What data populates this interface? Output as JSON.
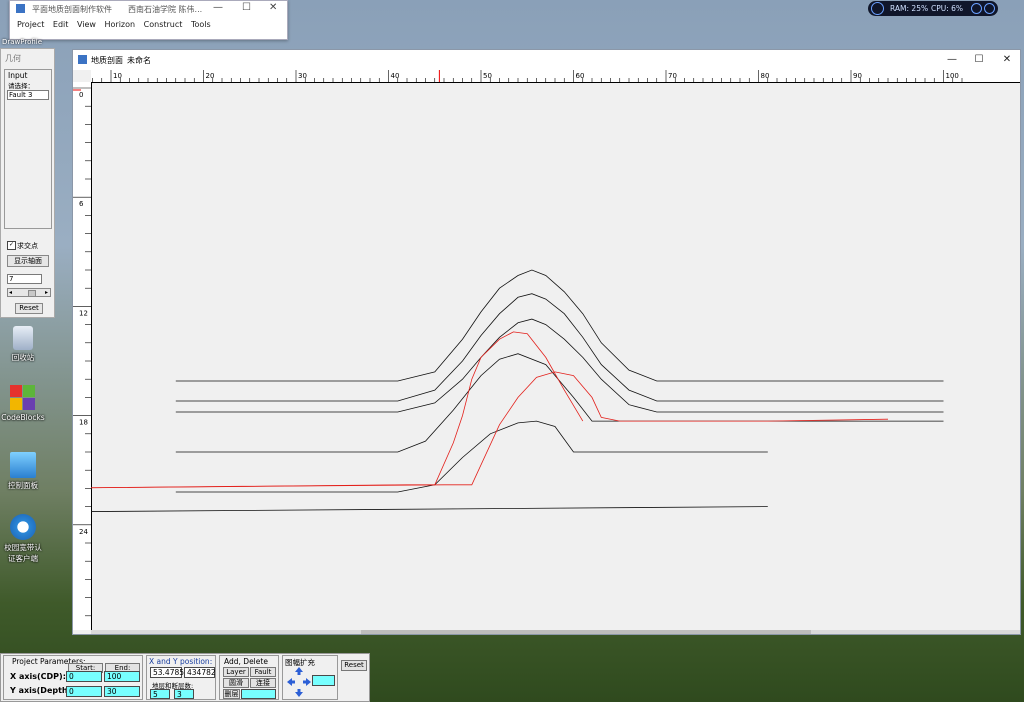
{
  "top_window": {
    "title": "平面地质剖面制作软件",
    "subtitle": "西南石油学院  陈伟...",
    "menu": [
      "Project",
      "Edit",
      "View",
      "Horizon",
      "Construct",
      "Tools"
    ],
    "controls": [
      "—",
      "☐",
      "✕"
    ]
  },
  "taskbar_label": "DrawProfile",
  "toolbox": {
    "title": "几何",
    "group_label": "Input",
    "hint": "请选择：",
    "selected_item": "Fault 3",
    "checkbox_label": "求交点",
    "checkbox_checked": true,
    "show_button": "显示轴面",
    "value_field": "7",
    "reset_button": "Reset"
  },
  "desktop_icons": [
    {
      "name": "recycle-bin",
      "label": "回收站"
    },
    {
      "name": "codeblocks",
      "label": "CodeBlocks"
    },
    {
      "name": "control-panel",
      "label": "控制面板"
    },
    {
      "name": "campus-auth",
      "label": "校园宽带认\n证客户端"
    }
  ],
  "main_window": {
    "title": "地质剖面",
    "doc_name": "未命名",
    "controls": [
      "—",
      "☐",
      "✕"
    ]
  },
  "rulers": {
    "x_ticks": [
      "10",
      "20",
      "30",
      "40",
      "50",
      "60",
      "70",
      "80",
      "90",
      "100"
    ],
    "y_ticks": [
      "0",
      "6",
      "12",
      "18",
      "24"
    ]
  },
  "cross_section": {
    "x_range": [
      0,
      100
    ],
    "depth_range": [
      0,
      30
    ],
    "horizons": [
      [
        [
          17,
          16.1
        ],
        [
          41,
          16.1
        ],
        [
          45,
          15.6
        ],
        [
          48,
          13.8
        ],
        [
          50,
          12.3
        ],
        [
          52,
          11.0
        ],
        [
          54,
          10.3
        ],
        [
          55.5,
          10.0
        ],
        [
          57,
          10.3
        ],
        [
          59,
          11.2
        ],
        [
          61,
          12.4
        ],
        [
          63,
          14.0
        ],
        [
          66,
          15.5
        ],
        [
          69,
          16.1
        ],
        [
          100,
          16.1
        ]
      ],
      [
        [
          17,
          17.2
        ],
        [
          41,
          17.2
        ],
        [
          45,
          16.6
        ],
        [
          48,
          15.0
        ],
        [
          50,
          13.6
        ],
        [
          52,
          12.4
        ],
        [
          54,
          11.5
        ],
        [
          55.5,
          11.3
        ],
        [
          57,
          11.6
        ],
        [
          59,
          12.4
        ],
        [
          61,
          13.7
        ],
        [
          63,
          15.2
        ],
        [
          66,
          16.6
        ],
        [
          69,
          17.2
        ],
        [
          100,
          17.2
        ]
      ],
      [
        [
          17,
          17.8
        ],
        [
          41,
          17.8
        ],
        [
          45,
          17.3
        ],
        [
          48,
          16.0
        ],
        [
          50,
          14.8
        ],
        [
          52,
          13.7
        ],
        [
          54,
          12.9
        ],
        [
          55.5,
          12.7
        ],
        [
          57,
          13.0
        ],
        [
          59,
          13.8
        ],
        [
          61,
          14.8
        ],
        [
          63,
          16.0
        ],
        [
          66,
          17.4
        ],
        [
          69,
          17.8
        ],
        [
          100,
          17.8
        ]
      ],
      [
        [
          17,
          20.0
        ],
        [
          41,
          20.0
        ],
        [
          44,
          19.4
        ],
        [
          47,
          17.7
        ],
        [
          50,
          15.8
        ],
        [
          52,
          14.9
        ],
        [
          54,
          14.6
        ],
        [
          57,
          15.2
        ],
        [
          60,
          17.0
        ],
        [
          62,
          18.3
        ],
        [
          100,
          18.3
        ]
      ],
      [
        [
          17,
          22.2
        ],
        [
          41,
          22.2
        ],
        [
          45,
          21.8
        ],
        [
          48,
          20.3
        ],
        [
          51,
          19.0
        ],
        [
          54,
          18.4
        ],
        [
          56,
          18.3
        ],
        [
          58,
          18.6
        ],
        [
          60,
          20.0
        ],
        [
          81,
          20.0
        ]
      ],
      [
        [
          0,
          23.3
        ],
        [
          81,
          23.0
        ]
      ]
    ],
    "faults": [
      [
        [
          0,
          22.0
        ],
        [
          42,
          21.8
        ],
        [
          45,
          21.8
        ],
        [
          47,
          19.5
        ],
        [
          48,
          18.0
        ],
        [
          49,
          16.0
        ],
        [
          50,
          14.8
        ],
        [
          52,
          13.8
        ],
        [
          53.5,
          13.4
        ],
        [
          55,
          13.5
        ],
        [
          57,
          14.8
        ],
        [
          59,
          16.6
        ],
        [
          61,
          18.3
        ]
      ],
      [
        [
          0,
          22.0
        ],
        [
          46,
          21.8
        ],
        [
          49,
          21.8
        ],
        [
          52,
          18.5
        ],
        [
          54,
          17.0
        ],
        [
          56,
          15.9
        ],
        [
          58,
          15.6
        ],
        [
          60,
          15.8
        ],
        [
          62,
          17.0
        ],
        [
          63,
          18.1
        ],
        [
          65,
          18.3
        ],
        [
          81,
          18.3
        ],
        [
          94,
          18.2
        ]
      ]
    ],
    "marker_x": 45.5
  },
  "bottom_panel": {
    "project_params_label": "Project Parameters:",
    "start_label": "Start:",
    "end_label": "End:",
    "x_axis_label": "X axis(CDP):",
    "y_axis_label": "Y axis(Depth ):",
    "x_start": "0",
    "x_end": "100",
    "y_start": "0",
    "y_end": "30",
    "xy_label": "X and Y position:",
    "x_pos": "53.4785",
    "y_pos": "434782",
    "counts_label": "地层和断层数:",
    "layer_count": "5",
    "fault_count": "3",
    "add_delete_label": "Add, Delete",
    "layer_button": "Layer",
    "fault_button": "Fault",
    "btn_a": "圆滑",
    "btn_b": "连接",
    "btn_c": "删层",
    "zoom_label": "图幅扩充",
    "reset_button": "Reset"
  },
  "sys_widget": {
    "ram": "RAM: 25%",
    "cpu": "CPU: 6%"
  }
}
